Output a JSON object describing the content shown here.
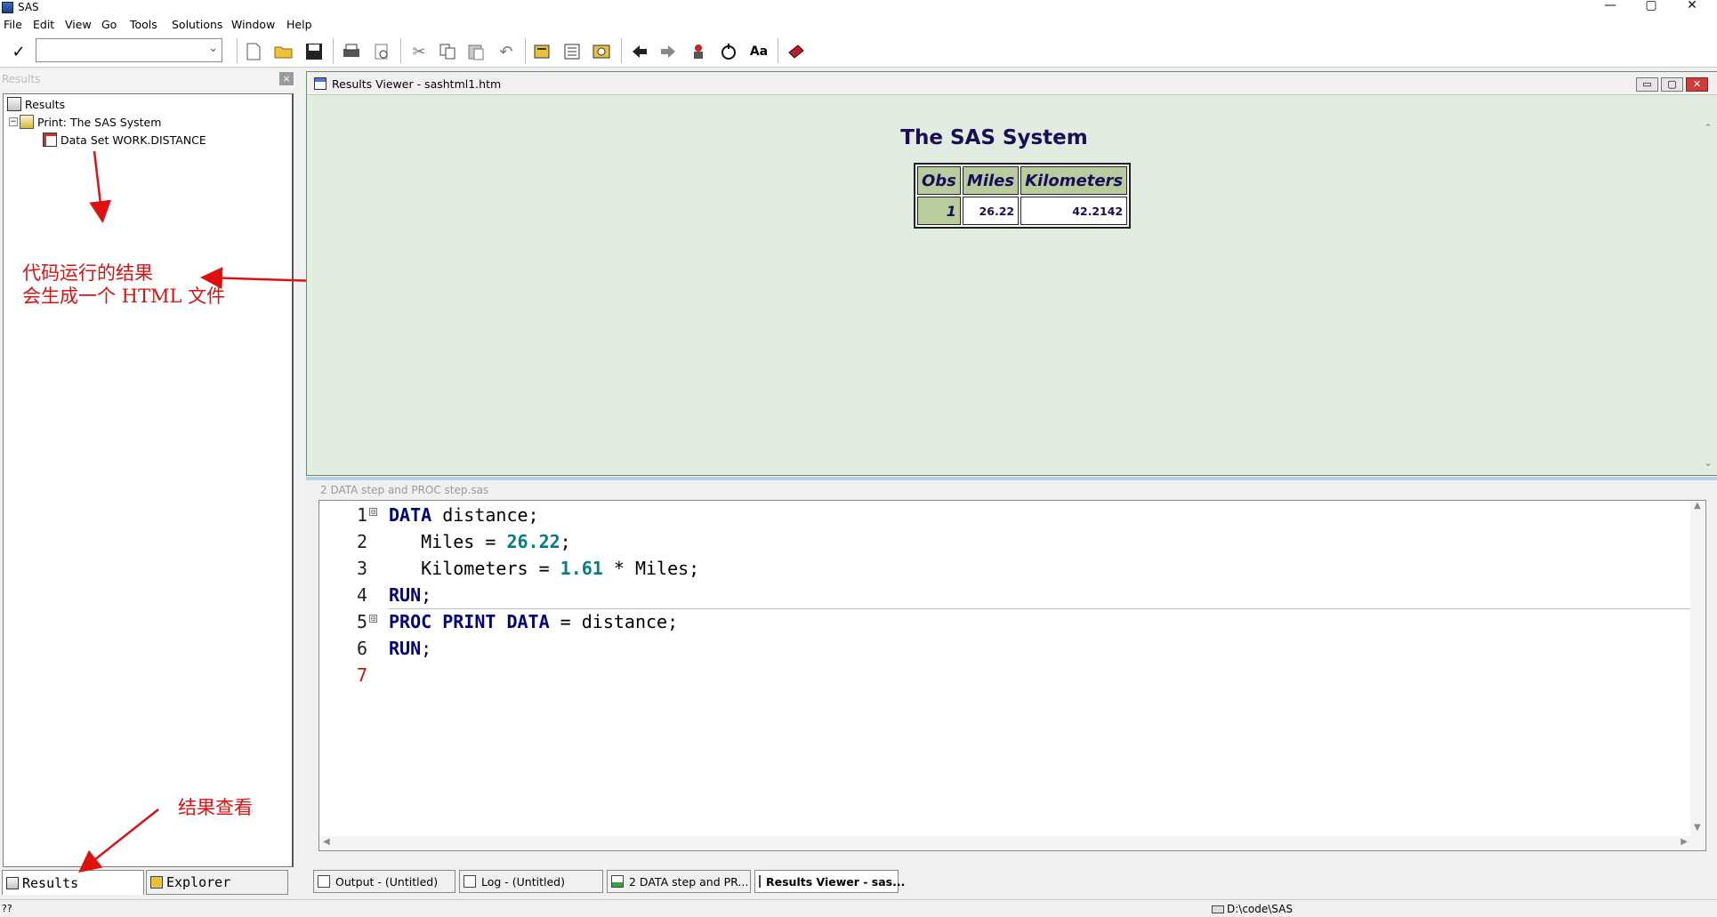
{
  "window": {
    "title": "SAS",
    "controls": [
      "—",
      "▢",
      "✕"
    ]
  },
  "menu": [
    "File",
    "Edit",
    "View",
    "Go",
    "Tools",
    "Solutions",
    "Window",
    "Help"
  ],
  "toolbar": {
    "check_icon": "checkmark-icon",
    "command_value": "",
    "buttons": [
      "new-icon",
      "open-icon",
      "save-icon",
      "print-icon",
      "print-preview-icon",
      "cut-icon",
      "copy-icon",
      "paste-icon",
      "undo-icon",
      "new-library-icon",
      "sas-explorer-icon",
      "query-icon",
      "back-icon",
      "forward-icon",
      "submit-icon",
      "clear-icon",
      "font-icon",
      "help-book-icon"
    ]
  },
  "results_pane": {
    "header": "Results",
    "close": "×",
    "tree": {
      "root": "Results",
      "print_node": "Print:  The SAS System",
      "dataset_node": "Data Set WORK.DISTANCE"
    },
    "tabs": [
      "Results",
      "Explorer"
    ]
  },
  "annotations": {
    "html_line1": "代码运行的结果",
    "html_line2": "会生成一个 HTML 文件",
    "view_results": "结果查看"
  },
  "results_viewer": {
    "title": "Results Viewer - sashtml1.htm",
    "report_title": "The SAS System",
    "table": {
      "headers": [
        "Obs",
        "Miles",
        "Kilometers"
      ],
      "rows": [
        [
          "1",
          "26.22",
          "42.2142"
        ]
      ]
    }
  },
  "editor": {
    "title": "2 DATA step and PROC step.sas",
    "lines": [
      {
        "num": "1",
        "fold": "⊟",
        "tokens": [
          {
            "t": "DATA",
            "c": "kw"
          },
          {
            "t": " distance;",
            "c": ""
          }
        ]
      },
      {
        "num": "2",
        "fold": "",
        "tokens": [
          {
            "t": "   Miles = ",
            "c": ""
          },
          {
            "t": "26.22",
            "c": "num"
          },
          {
            "t": ";",
            "c": ""
          }
        ]
      },
      {
        "num": "3",
        "fold": "",
        "tokens": [
          {
            "t": "   Kilometers = ",
            "c": ""
          },
          {
            "t": "1.61",
            "c": "num"
          },
          {
            "t": " * Miles;",
            "c": ""
          }
        ]
      },
      {
        "num": "4",
        "fold": "",
        "tokens": [
          {
            "t": "RUN",
            "c": "kw"
          },
          {
            "t": ";",
            "c": ""
          }
        ]
      },
      {
        "num": "5",
        "fold": "⊟",
        "tokens": [
          {
            "t": "PROC PRINT DATA",
            "c": "kw"
          },
          {
            "t": " = distance;",
            "c": ""
          }
        ]
      },
      {
        "num": "6",
        "fold": "",
        "tokens": [
          {
            "t": "RUN",
            "c": "kw"
          },
          {
            "t": ";",
            "c": ""
          }
        ]
      },
      {
        "num": "7",
        "fold": "",
        "tokens": []
      }
    ]
  },
  "taskbar": [
    "Output - (Untitled)",
    "Log - (Untitled)",
    "2 DATA step and PR...",
    "Results Viewer - sas..."
  ],
  "status": {
    "left": "??",
    "path": "D:\\code\\SAS"
  },
  "colors": {
    "annotation": "#e01010",
    "keyword": "#000080",
    "number": "#008080",
    "report_text": "#1a0d5a",
    "header_cell": "#b9cc9e",
    "viewer_bg": "#e2ece0"
  }
}
